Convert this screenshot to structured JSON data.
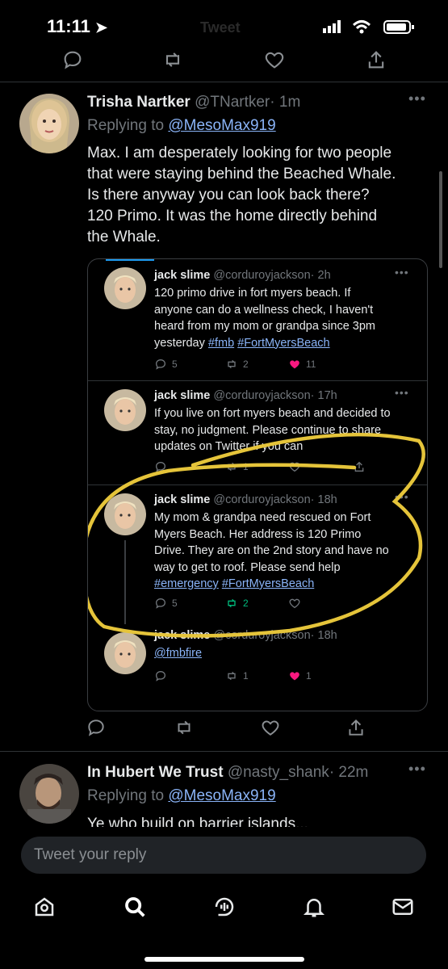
{
  "status_bar": {
    "time": "11:11"
  },
  "header": {
    "title": "Tweet"
  },
  "main_tweet": {
    "name": "Trisha Nartker",
    "handle": "@TNartker",
    "time": "· 1m",
    "replying_prefix": "Replying to",
    "replying_to": "@MesoMax919",
    "text_lines": [
      "Max.  I am desperately looking for two people",
      "that were staying behind the Beached Whale.",
      "Is there anyway you can look back there?",
      "120 Primo. It was the home directly behind",
      "the Whale."
    ]
  },
  "quoted_tweets": [
    {
      "name": "jack slime",
      "handle": "@corduroyjackson",
      "time": "· 2h",
      "text_lines": [
        "120 primo drive in fort myers beach. If",
        "anyone can do a wellness check, I haven't",
        "heard from my mom or grandpa since 3pm"
      ],
      "last_line": "yesterday",
      "hashtags": [
        "#fmb",
        "#FortMyersBeach"
      ],
      "replies": "5",
      "retweets": "2",
      "likes": "11"
    },
    {
      "name": "jack slime",
      "handle": "@corduroyjackson",
      "time": "· 17h",
      "text_lines": [
        "If you live on fort myers beach and decided to",
        "stay, no judgment. Please continue to share",
        "updates on Twitter if you can"
      ],
      "replies": "",
      "retweets": "1",
      "likes": ""
    },
    {
      "name": "jack slime",
      "handle": "@corduroyjackson",
      "time": "· 18h",
      "text_lines": [
        "My mom & grandpa need rescued on Fort",
        "Myers Beach. Her address is 120 Primo",
        "Drive. They are on the 2nd story and have no",
        "way to get to roof. Please send help"
      ],
      "hashtags": [
        "#emergency",
        "#FortMyersBeach"
      ],
      "replies": "5",
      "retweets": "2",
      "likes": ""
    },
    {
      "name": "jack slime",
      "handle": "@corduroyjackson",
      "time": "· 18h",
      "mention": "@fmbfire",
      "replies": "",
      "retweets": "1",
      "likes": "1"
    }
  ],
  "next_tweet": {
    "name": "In Hubert We Trust",
    "handle": "@nasty_shank",
    "time": "· 22m",
    "replying_prefix": "Replying to",
    "replying_to": "@MesoMax919",
    "text": "Ye who build on barrier islands..."
  },
  "reply_input": {
    "placeholder": "Tweet your reply"
  },
  "colors": {
    "like_pink": "#f91880",
    "retweet_green": "#00ba7c",
    "link_blue": "#8ab4f8",
    "annotation_yellow": "#e5c43a"
  },
  "icons": [
    "reply-icon",
    "retweet-icon",
    "like-icon",
    "share-icon",
    "more-icon",
    "home-icon",
    "search-icon",
    "spaces-icon",
    "notifications-icon",
    "messages-icon"
  ]
}
